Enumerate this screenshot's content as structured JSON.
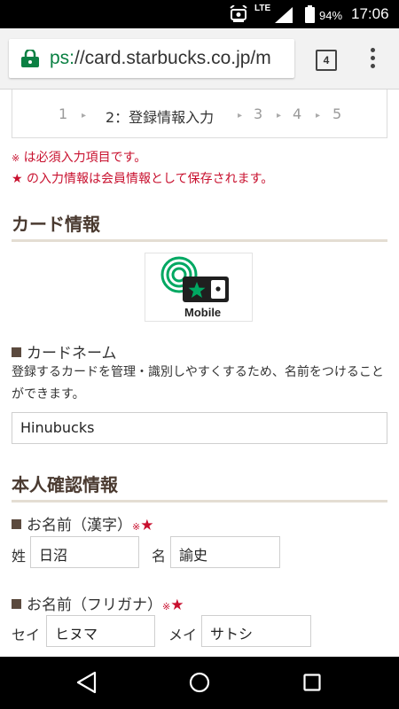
{
  "status_bar": {
    "network": "LTE",
    "battery_pct": "94%",
    "battery_level": 0.94,
    "time": "17:06",
    "icons": [
      "notification-icon",
      "signal-icon",
      "battery-icon"
    ]
  },
  "browser": {
    "url_scheme": "ps:",
    "url_host": "//card.starbucks.co.jp/m",
    "tab_count": "4",
    "icons": [
      "lock-icon",
      "tabs-icon",
      "overflow-menu-icon"
    ]
  },
  "steps": {
    "items": [
      "1",
      "2：登録情報入力",
      "3",
      "4",
      "5"
    ],
    "active_index": 1
  },
  "notes": {
    "required_mark": "※",
    "required_text": "は必須入力項目です。",
    "star_mark": "★",
    "star_text": "の入力情報は会員情報として保存されます。"
  },
  "card_section": {
    "title": "カード情報",
    "card_label": "Mobile",
    "card_name": {
      "label": "カードネーム",
      "description": "登録するカードを管理・識別しやすくするため、名前をつけることができます。",
      "value": "Hinubucks"
    }
  },
  "identity_section": {
    "title": "本人確認情報",
    "name_kanji": {
      "label": "お名前（漢字）",
      "req_mark": "※",
      "star": "★",
      "last_label": "姓",
      "last_value": "日沼",
      "first_label": "名",
      "first_value": "諭史"
    },
    "name_kana": {
      "label": "お名前（フリガナ）",
      "req_mark": "※",
      "star": "★",
      "last_label": "セイ",
      "last_value": "ヒヌマ",
      "first_label": "メイ",
      "first_value": "サトシ"
    }
  },
  "colors": {
    "required_red": "#c8102e",
    "heading_brown": "#4a3a30",
    "starbucks_green": "#00a862",
    "secure_green": "#0b8043"
  },
  "nav_bar": {
    "icons": [
      "back-icon",
      "home-icon",
      "recent-apps-icon"
    ]
  }
}
